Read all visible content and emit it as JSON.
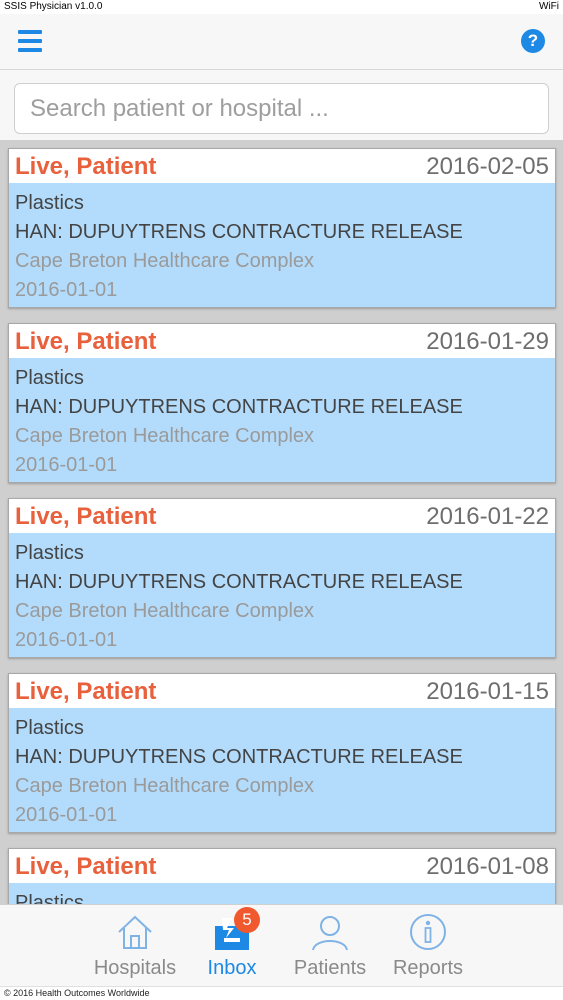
{
  "status_bar": {
    "app_name": "SSIS Physician v1.0.0",
    "network": "WiFi"
  },
  "nav": {
    "menu_icon": "hamburger-icon",
    "help_icon": "help-icon",
    "help_glyph": "?"
  },
  "search": {
    "placeholder": "Search patient or hospital ...",
    "value": ""
  },
  "cards": [
    {
      "name": "Live, Patient",
      "date": "2016-02-05",
      "specialty": "Plastics",
      "procedure": "HAN: DUPUYTRENS CONTRACTURE RELEASE",
      "hospital": "Cape Breton Healthcare Complex",
      "surgery_date": "2016-01-01"
    },
    {
      "name": "Live, Patient",
      "date": "2016-01-29",
      "specialty": "Plastics",
      "procedure": "HAN: DUPUYTRENS CONTRACTURE RELEASE",
      "hospital": "Cape Breton Healthcare Complex",
      "surgery_date": "2016-01-01"
    },
    {
      "name": "Live, Patient",
      "date": "2016-01-22",
      "specialty": "Plastics",
      "procedure": "HAN: DUPUYTRENS CONTRACTURE RELEASE",
      "hospital": "Cape Breton Healthcare Complex",
      "surgery_date": "2016-01-01"
    },
    {
      "name": "Live, Patient",
      "date": "2016-01-15",
      "specialty": "Plastics",
      "procedure": "HAN: DUPUYTRENS CONTRACTURE RELEASE",
      "hospital": "Cape Breton Healthcare Complex",
      "surgery_date": "2016-01-01"
    },
    {
      "name": "Live, Patient",
      "date": "2016-01-08",
      "specialty": "Plastics",
      "procedure": "",
      "hospital": "",
      "surgery_date": ""
    }
  ],
  "tabs": [
    {
      "label": "Hospitals",
      "icon": "house-icon",
      "active": false
    },
    {
      "label": "Inbox",
      "icon": "inbox-icon",
      "active": true,
      "badge": "5"
    },
    {
      "label": "Patients",
      "icon": "person-icon",
      "active": false
    },
    {
      "label": "Reports",
      "icon": "info-icon",
      "active": false
    }
  ],
  "footer": {
    "copyright": "© 2016 Health Outcomes Worldwide"
  },
  "colors": {
    "accent": "#1e88e5",
    "name": "#e8603c",
    "card_bg": "#b3dcfc",
    "badge": "#f0582e"
  }
}
